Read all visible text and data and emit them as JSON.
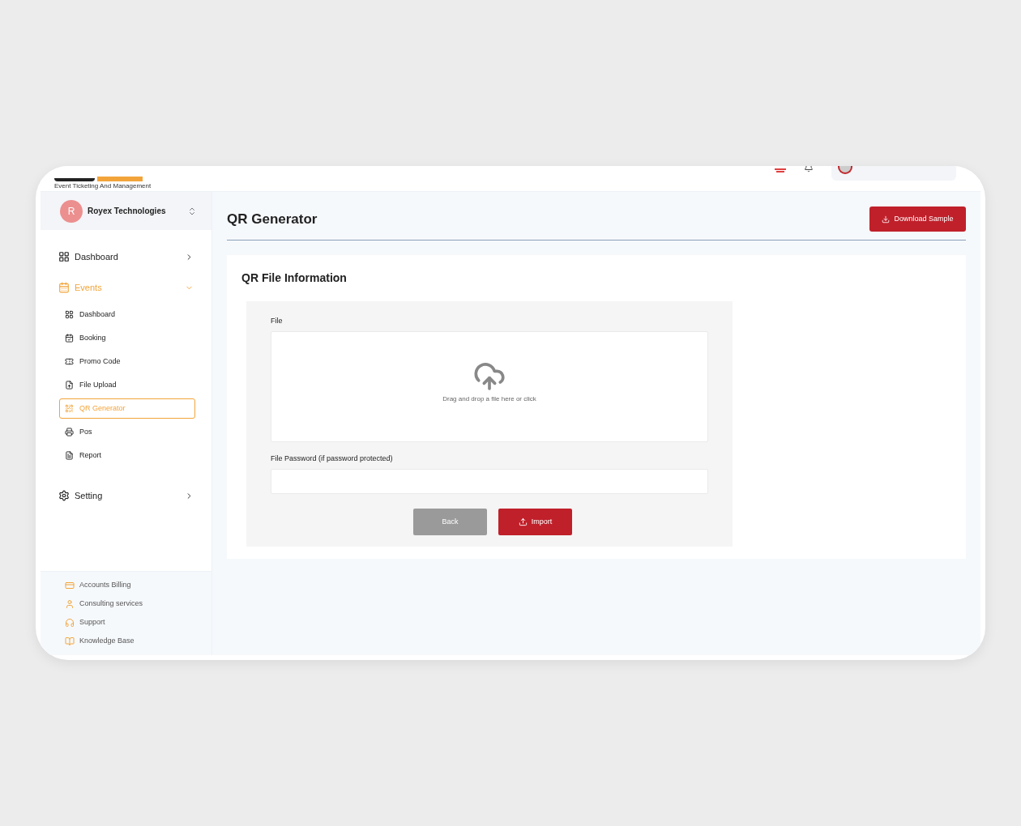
{
  "header": {
    "tagline": "Event Ticketing And Management"
  },
  "org": {
    "initial": "R",
    "name": "Royex Technologies"
  },
  "nav": [
    {
      "label": "Dashboard",
      "selected": false,
      "expanded": false
    },
    {
      "label": "Events",
      "selected": true,
      "expanded": true,
      "children": [
        {
          "label": "Dashboard",
          "selected": false
        },
        {
          "label": "Booking",
          "selected": false
        },
        {
          "label": "Promo Code",
          "selected": false
        },
        {
          "label": "File Upload",
          "selected": false
        },
        {
          "label": "QR Generator",
          "selected": true
        },
        {
          "label": "Pos",
          "selected": false
        },
        {
          "label": "Report",
          "selected": false
        }
      ]
    },
    {
      "label": "Setting",
      "selected": false,
      "expanded": false
    }
  ],
  "footer_links": [
    "Accounts Billing",
    "Consulting services",
    "Support",
    "Knowledge Base"
  ],
  "page": {
    "title": "QR Generator",
    "download_button": "Download Sample",
    "section_title": "QR File Information",
    "file_label": "File",
    "dropzone_text": "Drag and drop a file here or click",
    "password_label": "File Password (if password protected)",
    "back_button": "Back",
    "import_button": "Import"
  }
}
